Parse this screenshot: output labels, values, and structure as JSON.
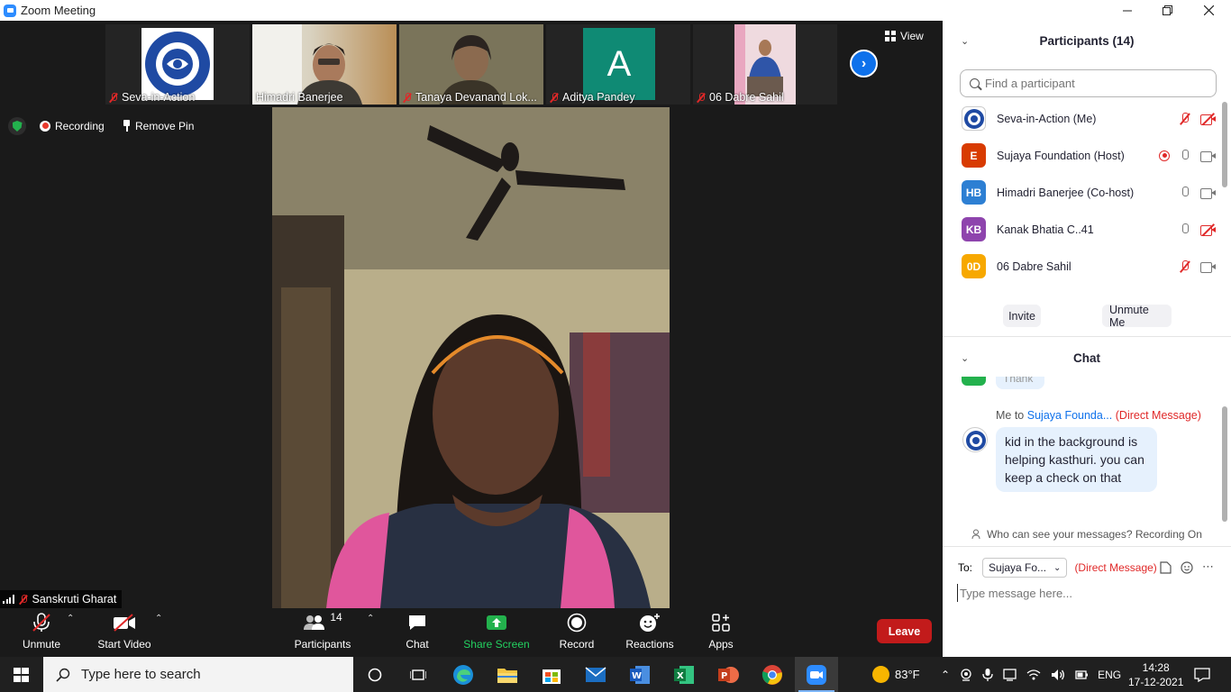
{
  "window": {
    "title": "Zoom Meeting",
    "controls": [
      "minimize",
      "maximize",
      "close"
    ]
  },
  "gallery": {
    "tiles": [
      {
        "name": "Seva-in-Action",
        "muted": true
      },
      {
        "name": "Himadri Banerjee",
        "muted": false
      },
      {
        "name": "Tanaya Devanand Lok...",
        "muted": true
      },
      {
        "name": "Aditya Pandey",
        "muted": true,
        "avatar_letter": "A"
      },
      {
        "name": "06 Dabre Sahil",
        "muted": true
      }
    ],
    "view_label": "View",
    "logo_text": "SEVA IN ACTION"
  },
  "overlay": {
    "recording_label": "Recording",
    "remove_pin_label": "Remove Pin"
  },
  "speaker": {
    "name": "Sanskruti Gharat"
  },
  "toolbar": {
    "unmute_label": "Unmute",
    "start_video_label": "Start Video",
    "participants_label": "Participants",
    "participants_count": "14",
    "chat_label": "Chat",
    "share_screen_label": "Share Screen",
    "record_label": "Record",
    "reactions_label": "Reactions",
    "apps_label": "Apps",
    "leave_label": "Leave"
  },
  "participants_panel": {
    "title": "Participants (14)",
    "search_placeholder": "Find a participant",
    "items": [
      {
        "avatar": "",
        "color": "#ffffff",
        "name": "Seva-in-Action (Me)",
        "mic": "off",
        "cam": "off",
        "recording": false
      },
      {
        "avatar": "E",
        "color": "#d83b01",
        "name": "Sujaya Foundation (Host)",
        "mic": "on",
        "cam": "on",
        "recording": true
      },
      {
        "avatar": "HB",
        "color": "#2d7fd3",
        "name": "Himadri Banerjee (Co-host)",
        "mic": "on",
        "cam": "on",
        "recording": false
      },
      {
        "avatar": "KB",
        "color": "#8e44ad",
        "name": "Kanak Bhatia C..41",
        "mic": "on",
        "cam": "off",
        "recording": false
      },
      {
        "avatar": "0D",
        "color": "#f7a800",
        "name": "06 Dabre Sahil",
        "mic": "off",
        "cam": "on",
        "recording": false
      }
    ],
    "invite_label": "Invite",
    "unmute_me_label": "Unmute Me"
  },
  "chat_panel": {
    "title": "Chat",
    "previous_message": "Thank",
    "message": {
      "sender": "Me to ",
      "recipient": "Sujaya Founda...",
      "tag": "(Direct Message)",
      "text": "kid in the background is helping kasthuri. you can keep a check on that"
    },
    "visibility_note": "Who can see your messages? Recording On",
    "to_label": "To:",
    "to_selected": "Sujaya Fo...",
    "to_tag": "(Direct Message)",
    "input_placeholder": "Type message here..."
  },
  "taskbar": {
    "search_placeholder": "Type here to search",
    "weather": "83°F",
    "language": "ENG",
    "time": "14:28",
    "date": "17-12-2021"
  }
}
